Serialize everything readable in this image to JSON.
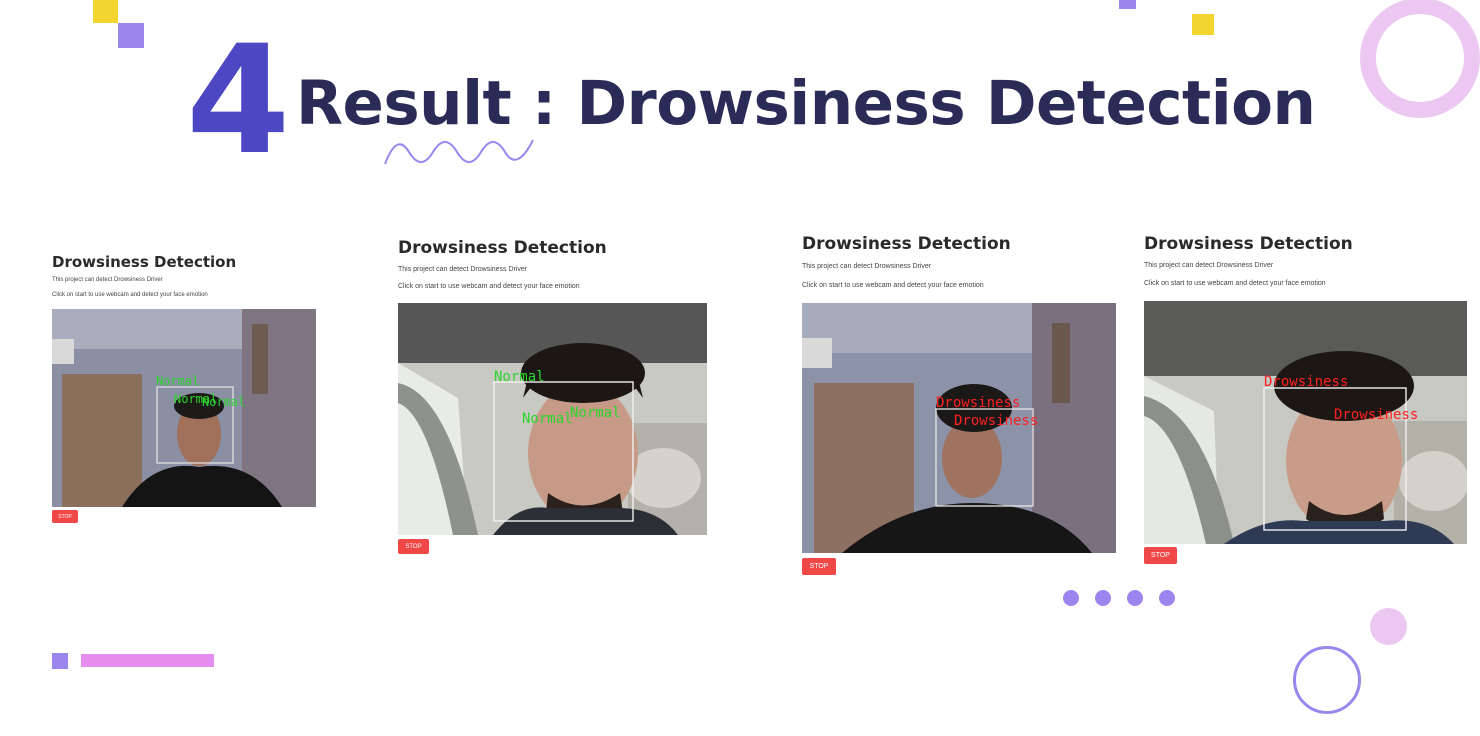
{
  "slide": {
    "number": "4",
    "title": "Result : Drowsiness Detection"
  },
  "screenshots": [
    {
      "heading": "Drowsiness Detection",
      "line1": "This project can detect Drowsiness Driver",
      "line2": "Click on start to use webcam and detect your face emotion",
      "stop_label": "STOP",
      "labels": [
        "Normal",
        "Normal",
        "Normal"
      ]
    },
    {
      "heading": "Drowsiness Detection",
      "line1": "This project can detect Drowsiness Driver",
      "line2": "Click on start to use webcam and detect your face emotion",
      "stop_label": "STOP",
      "labels": [
        "Normal",
        "Normal",
        "Normal"
      ]
    },
    {
      "heading": "Drowsiness Detection",
      "line1": "This project can detect Drowsiness Driver",
      "line2": "Click on start to use webcam and detect your face emotion",
      "stop_label": "STOP",
      "labels": [
        "Drowsiness",
        "Drowsiness"
      ]
    },
    {
      "heading": "Drowsiness Detection",
      "line1": "This project can detect Drowsiness Driver",
      "line2": "Click on start to use webcam and detect your face emotion",
      "stop_label": "STOP",
      "labels": [
        "Drowsiness",
        "Drowsiness"
      ]
    }
  ],
  "colors": {
    "accent_blue": "#4d47c3",
    "title_navy": "#2b2b57",
    "deco_purple": "#9b86ee",
    "deco_yellow": "#f2d52e",
    "deco_pink": "#e7c3f0",
    "stop_red": "#f04747",
    "label_normal": "#2bd62b",
    "label_drowsy": "#ff2020"
  }
}
